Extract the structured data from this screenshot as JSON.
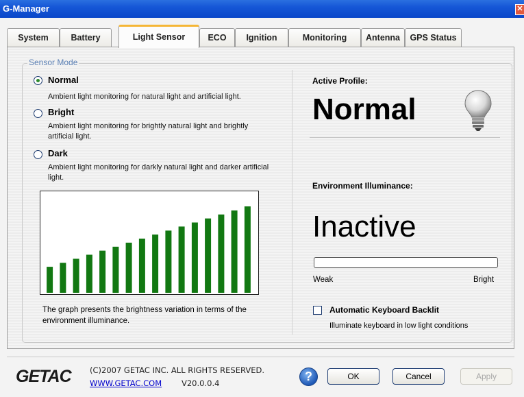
{
  "window": {
    "title": "G-Manager",
    "close_glyph": "✕"
  },
  "tabs": [
    {
      "label": "System",
      "active": false
    },
    {
      "label": "Battery",
      "active": false
    },
    {
      "label": "Light Sensor",
      "active": true
    },
    {
      "label": "ECO",
      "active": false
    },
    {
      "label": "Ignition",
      "active": false
    },
    {
      "label": "Monitoring",
      "active": false
    },
    {
      "label": "Antenna",
      "active": false
    },
    {
      "label": "GPS Status",
      "active": false
    }
  ],
  "sensor_mode": {
    "legend": "Sensor Mode",
    "selected": "Normal",
    "options": [
      {
        "label": "Normal",
        "description": "Ambient light monitoring for natural light and artificial light."
      },
      {
        "label": "Bright",
        "description": "Ambient light monitoring for brightly natural light and brightly artificial light."
      },
      {
        "label": "Dark",
        "description": "Ambient light monitoring for darkly natural light and darker artificial light."
      }
    ]
  },
  "chart_data": {
    "type": "bar",
    "values": [
      1,
      2,
      3,
      4,
      5,
      6,
      7,
      8,
      9,
      10,
      11,
      12,
      13,
      14,
      15,
      16
    ],
    "color": "#127812",
    "background": "#ffffff",
    "ylim": [
      0,
      16
    ]
  },
  "graph_caption": "The graph presents the brightness variation in terms of the environment illuminance.",
  "profile": {
    "title": "Active Profile:",
    "value": "Normal",
    "icon": "light-bulb-icon"
  },
  "illuminance": {
    "title": "Environment Illuminance:",
    "status": "Inactive",
    "level": 0,
    "min_label": "Weak",
    "max_label": "Bright"
  },
  "keyboard_backlit": {
    "label": "Automatic Keyboard Backlit",
    "description": "Illuminate keyboard in low light conditions",
    "checked": false
  },
  "footer": {
    "logo": "GETAC",
    "copyright": "(C)2007 GETAC INC. ALL RIGHTS RESERVED.",
    "website": "WWW.GETAC.COM",
    "version": "V20.0.0.4",
    "help_glyph": "?"
  },
  "buttons": {
    "ok": "OK",
    "cancel": "Cancel",
    "apply": "Apply"
  },
  "colors": {
    "title_bar": "#0a47c9",
    "active_tab_accent": "#f5b635",
    "bars": "#127812",
    "link": "#0000cc"
  }
}
